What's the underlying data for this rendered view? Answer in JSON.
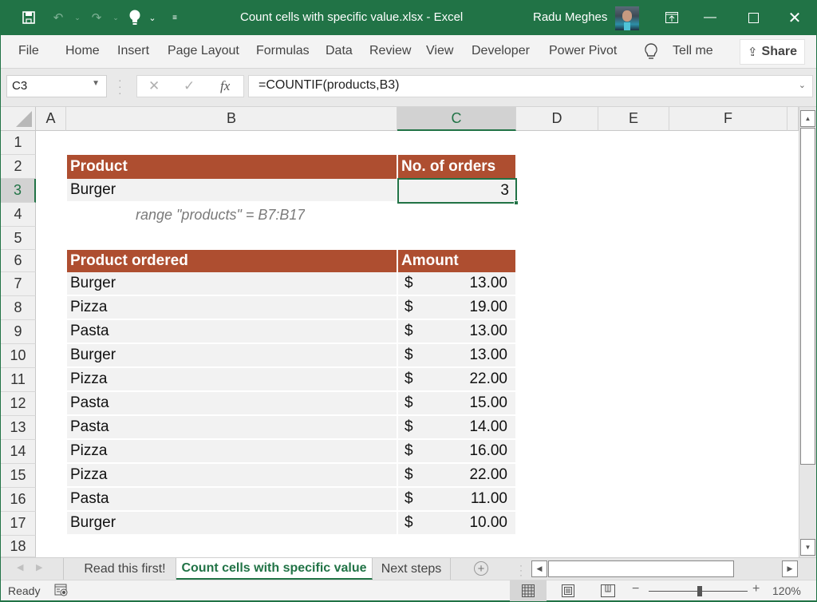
{
  "titlebar": {
    "file_title": "Count cells with specific value.xlsx  -  Excel",
    "user_name": "Radu Meghes",
    "quick_access": [
      "save-icon",
      "undo-icon",
      "redo-icon",
      "lightbulb-icon",
      "customize-icon"
    ]
  },
  "ribbon": {
    "tabs": [
      "File",
      "Home",
      "Insert",
      "Page Layout",
      "Formulas",
      "Data",
      "Review",
      "View",
      "Developer",
      "Power Pivot"
    ],
    "tell_me": "Tell me",
    "share": "Share"
  },
  "formula_bar": {
    "name_box": "C3",
    "cancel": "✕",
    "enter": "✓",
    "fx": "fx",
    "formula": "=COUNTIF(products,B3)"
  },
  "grid": {
    "columns": [
      "A",
      "B",
      "C",
      "D",
      "E",
      "F"
    ],
    "selected_column": "C",
    "rows": [
      "1",
      "2",
      "3",
      "4",
      "5",
      "6",
      "7",
      "8",
      "9",
      "10",
      "11",
      "12",
      "13",
      "14",
      "15",
      "16",
      "17",
      "18"
    ],
    "selected_row": "3",
    "lookup_table": {
      "headers": [
        "Product",
        "No. of orders"
      ],
      "product": "Burger",
      "count": "3"
    },
    "note": "range \"products\" = B7:B17",
    "orders_table": {
      "headers": [
        "Product ordered",
        "Amount"
      ],
      "currency": "$",
      "rows": [
        {
          "product": "Burger",
          "amount": "13.00"
        },
        {
          "product": "Pizza",
          "amount": "19.00"
        },
        {
          "product": "Pasta",
          "amount": "13.00"
        },
        {
          "product": "Burger",
          "amount": "13.00"
        },
        {
          "product": "Pizza",
          "amount": "22.00"
        },
        {
          "product": "Pasta",
          "amount": "15.00"
        },
        {
          "product": "Pasta",
          "amount": "14.00"
        },
        {
          "product": "Pizza",
          "amount": "16.00"
        },
        {
          "product": "Pizza",
          "amount": "22.00"
        },
        {
          "product": "Pasta",
          "amount": "11.00"
        },
        {
          "product": "Burger",
          "amount": "10.00"
        }
      ]
    }
  },
  "sheet_tabs": {
    "tabs": [
      "Read this first!",
      "Count cells with specific value",
      "Next steps"
    ],
    "active": "Count cells with specific value"
  },
  "status_bar": {
    "status": "Ready",
    "zoom_level": "120%",
    "zoom_percent": 120
  },
  "colors": {
    "excel_green": "#217346",
    "header_fill": "#ae4e30",
    "body_fill": "#f2f2f2"
  }
}
